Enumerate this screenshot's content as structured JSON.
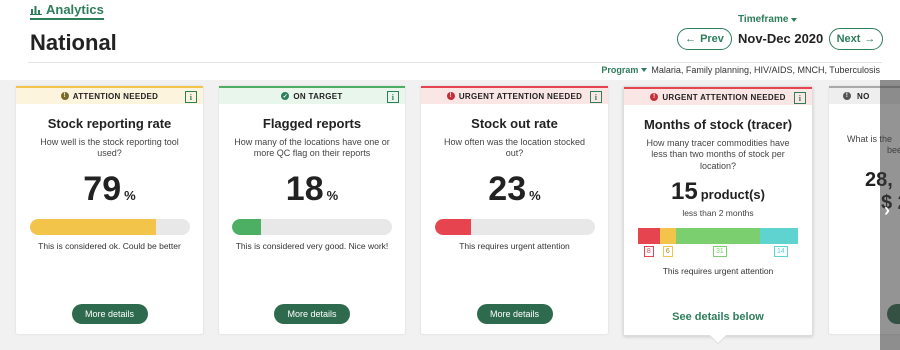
{
  "header": {
    "tab_label": "Analytics",
    "title": "National",
    "timeframe_label": "Timeframe",
    "timeframe_value": "Nov-Dec 2020",
    "prev_label": "Prev",
    "next_label": "Next",
    "program_label": "Program",
    "program_value": "Malaria, Family planning, HIV/AIDS, MNCH, Tuberculosis"
  },
  "colors": {
    "accent": "#2e7d5b",
    "button": "#2e6b4e",
    "warn": "#f2c449",
    "ok": "#4caf63",
    "urgent": "#e6454f",
    "teal": "#5fd3cf"
  },
  "cards": [
    {
      "status": "ATTENTION NEEDED",
      "title": "Stock reporting rate",
      "question": "How well is the stock reporting tool used?",
      "value": "79",
      "unit": "%",
      "progress": 0.79,
      "note": "This is considered ok. Could be better",
      "button": "More details"
    },
    {
      "status": "ON TARGET",
      "title": "Flagged reports",
      "question": "How many of the locations have one or more QC flag on their reports",
      "value": "18",
      "unit": "%",
      "progress": 0.18,
      "note": "This is considered very good. Nice work!",
      "button": "More details"
    },
    {
      "status": "URGENT ATTENTION NEEDED",
      "title": "Stock out rate",
      "question": "How often was the location stocked out?",
      "value": "23",
      "unit": "%",
      "progress": 0.23,
      "note": "This requires urgent attention",
      "button": "More details"
    },
    {
      "status": "URGENT ATTENTION NEEDED",
      "title": "Months of stock (tracer)",
      "question": "How many tracer commodities have less than two months of stock per location?",
      "value": "15",
      "unit": "product(s)",
      "sub": "less than 2 months",
      "segments": [
        {
          "label": "8",
          "value": 8,
          "color": "#e6454f"
        },
        {
          "label": "6",
          "value": 6,
          "color": "#f2c449"
        },
        {
          "label": "31",
          "value": 31,
          "color": "#7bcf6e"
        },
        {
          "label": "14",
          "value": 14,
          "color": "#5fd3cf"
        }
      ],
      "note": "This requires urgent attention",
      "link": "See details below"
    },
    {
      "status": "NO",
      "question_a": "What is the",
      "question_b": "bee",
      "value_a": "28,",
      "value_b": "$ 2",
      "button": "M"
    }
  ]
}
